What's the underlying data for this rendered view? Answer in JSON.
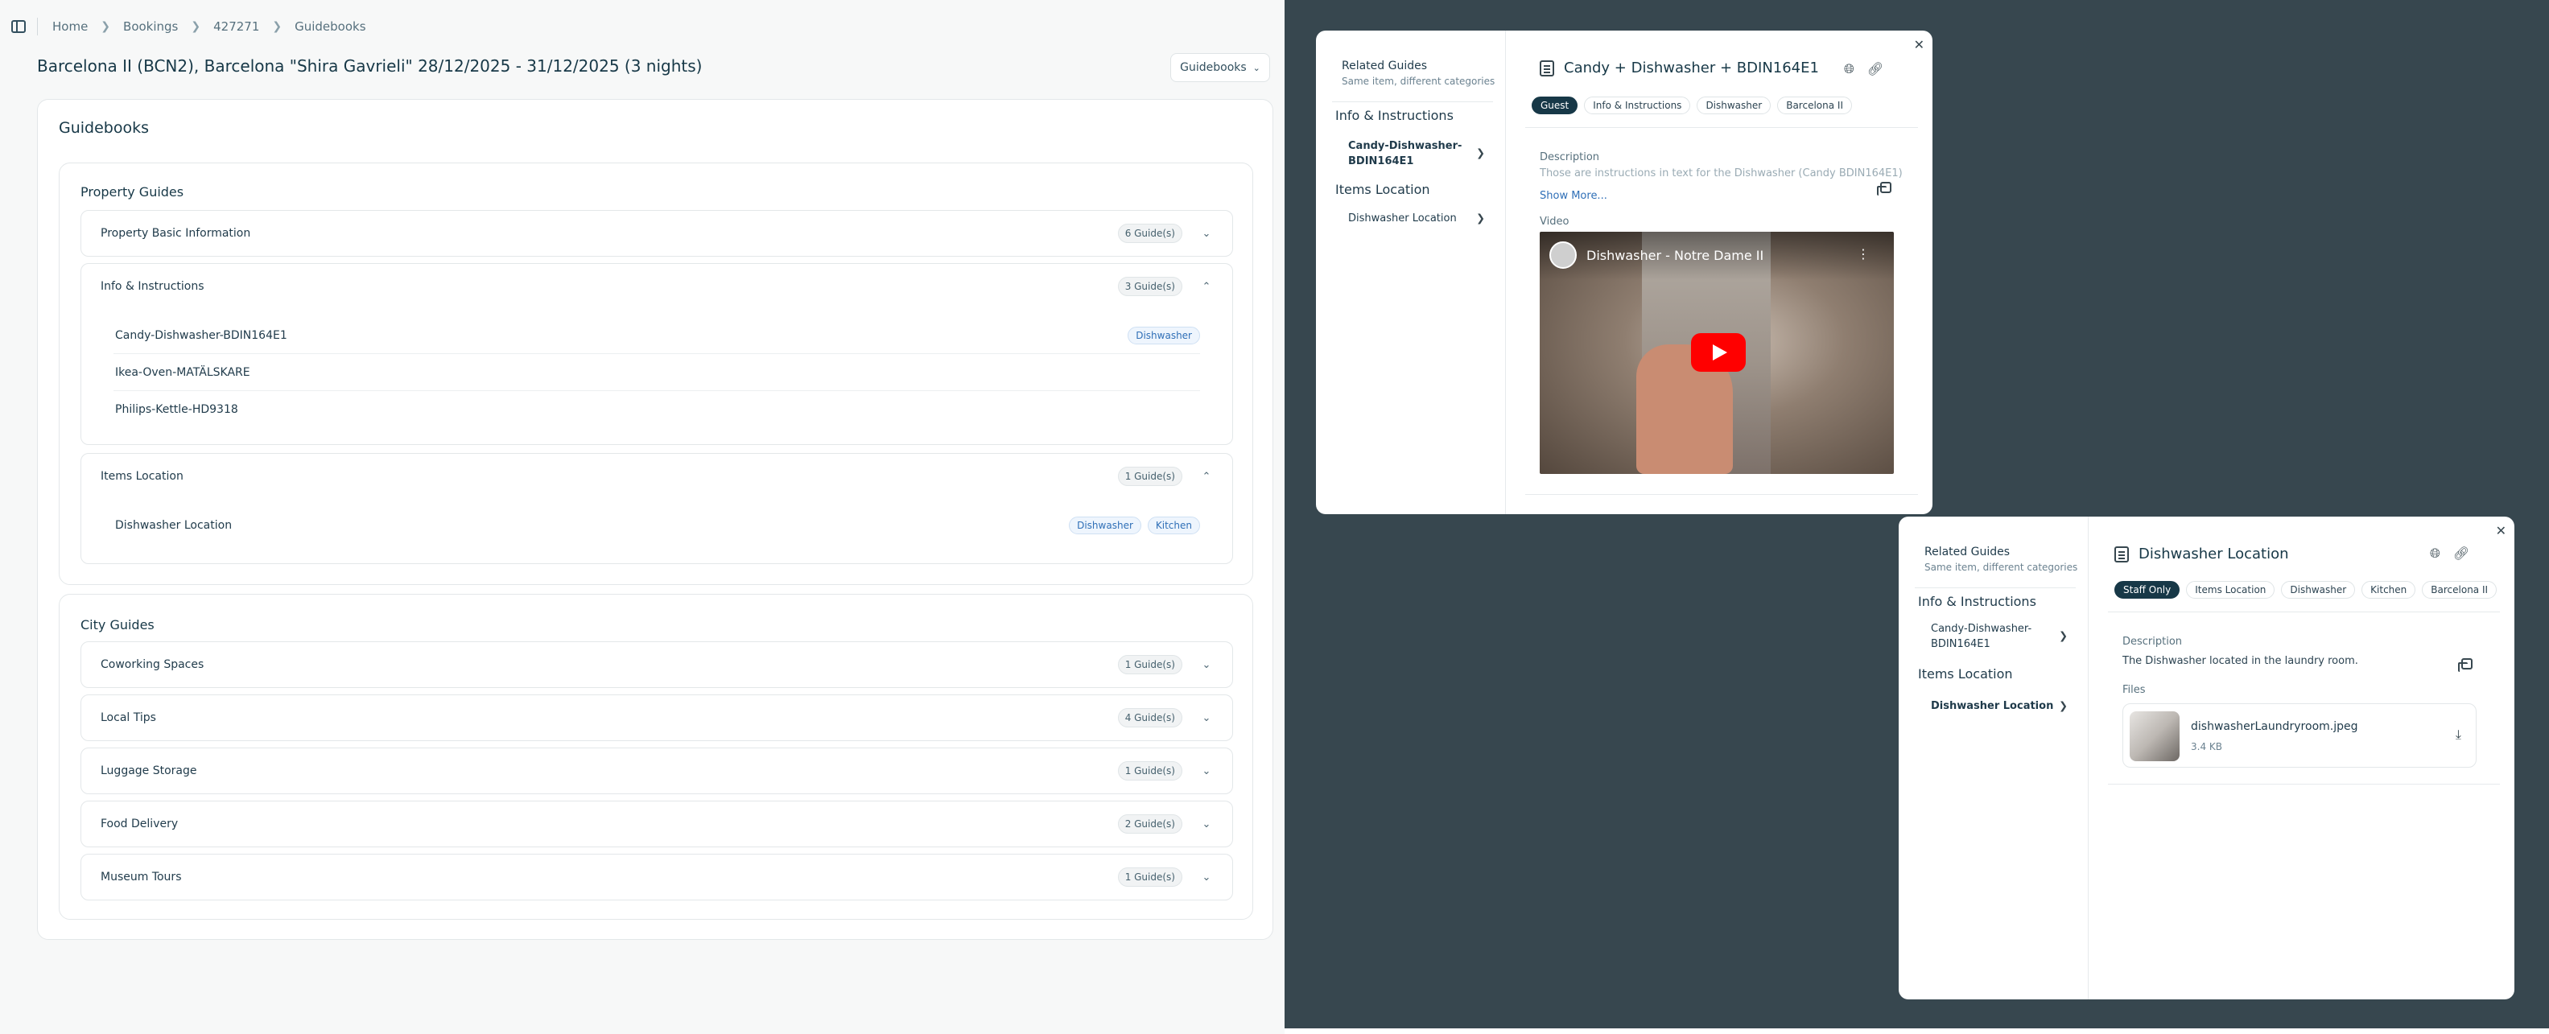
{
  "breadcrumb": [
    "Home",
    "Bookings",
    "427271",
    "Guidebooks"
  ],
  "page_title": "Barcelona II (BCN2), Barcelona \"Shira Gavrieli\" 28/12/2025 - 31/12/2025 (3 nights)",
  "guidebooks_select": "Guidebooks",
  "card_title": "Guidebooks",
  "property_guides": {
    "title": "Property Guides",
    "items": [
      {
        "label": "Property Basic Information",
        "count": "6 Guide(s)"
      },
      {
        "label": "Info & Instructions",
        "count": "3 Guide(s)",
        "rows": [
          {
            "label": "Candy-Dishwasher-BDIN164E1",
            "tags": [
              "Dishwasher"
            ]
          },
          {
            "label": "Ikea-Oven-MATÄLSKARE"
          },
          {
            "label": "Philips-Kettle-HD9318"
          }
        ]
      },
      {
        "label": "Items Location",
        "count": "1 Guide(s)",
        "rows": [
          {
            "label": "Dishwasher Location",
            "tags": [
              "Dishwasher",
              "Kitchen"
            ]
          }
        ]
      }
    ]
  },
  "city_guides": {
    "title": "City Guides",
    "items": [
      {
        "label": "Coworking Spaces",
        "count": "1 Guide(s)"
      },
      {
        "label": "Local Tips",
        "count": "4 Guide(s)"
      },
      {
        "label": "Luggage Storage",
        "count": "1 Guide(s)"
      },
      {
        "label": "Food Delivery",
        "count": "2 Guide(s)"
      },
      {
        "label": "Museum Tours",
        "count": "1 Guide(s)"
      }
    ]
  },
  "modal1": {
    "related_title": "Related Guides",
    "related_sub": "Same item, different categories",
    "categories": [
      {
        "head": "Info & Instructions",
        "item": "Candy-Dishwasher-BDIN164E1"
      },
      {
        "head": "Items Location",
        "item": "Dishwasher Location"
      }
    ],
    "title": "Candy + Dishwasher + BDIN164E1",
    "tags": [
      "Guest",
      "Info & Instructions",
      "Dishwasher",
      "Barcelona II"
    ],
    "description_label": "Description",
    "description": "Those are instructions in text for the Dishwasher (Candy BDIN164E1)",
    "show_more": "Show More...",
    "video_label": "Video",
    "video_title": "Dishwasher - Notre Dame II"
  },
  "modal2": {
    "related_title": "Related Guides",
    "related_sub": "Same item, different categories",
    "categories": [
      {
        "head": "Info & Instructions",
        "item": "Candy-Dishwasher-BDIN164E1"
      },
      {
        "head": "Items Location",
        "item": "Dishwasher Location"
      }
    ],
    "title": "Dishwasher Location",
    "tags": [
      "Staff Only",
      "Items Location",
      "Dishwasher",
      "Kitchen",
      "Barcelona II"
    ],
    "description_label": "Description",
    "description": "The Dishwasher located in the laundry room.",
    "files_label": "Files",
    "file": {
      "name": "dishwasherLaundryroom.jpeg",
      "size": "3.4 KB"
    }
  },
  "icons": {
    "sidebar_toggle": "sidebar-toggle-icon",
    "chevron_right": "chevron-right-icon",
    "chevron_down": "chevron-down-icon",
    "chevron_up": "chevron-up-icon",
    "close": "close-icon",
    "globe": "globe-icon",
    "link": "link-icon",
    "copy": "copy-icon",
    "download": "download-icon",
    "book": "book-icon"
  },
  "colors": {
    "overlay": "#37474f",
    "accent_dark": "#173847",
    "link_blue": "#2f6fb7",
    "play_red": "#ff0000"
  }
}
